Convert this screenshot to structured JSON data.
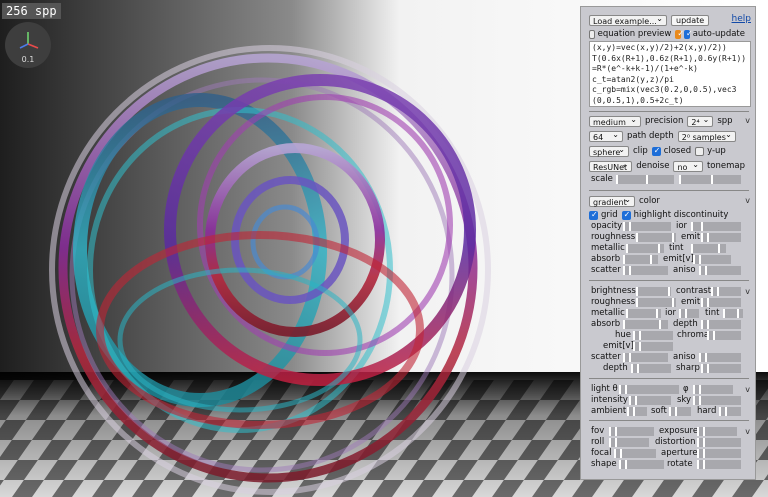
{
  "viewport": {
    "spp": "256 spp",
    "zoom": "0.1"
  },
  "panel": {
    "load_example": "Load example...",
    "update": "update",
    "help": "help",
    "equation_preview": "equation preview",
    "auto_update": "auto-update",
    "code": "(x,y)=vec(x,y)/2)+2(x,y)/2))\nT(0.6x(R+1),0.6z(R+1),0.6y(R+1))=R*(e^-k+k-1)/(1+e^-k)\nc_t=atan2(y,z)/pi\nc_rgb=mix(vec3(0.2,0,0.5),vec3(0,0.5,1),0.5+2c_t)",
    "quality": {
      "precision_value": "medium",
      "precision_label": "precision",
      "spp_value": "2⁴",
      "spp_label": "spp",
      "depth_value": "64",
      "depth_label": "path depth",
      "samples_value": "2⁰ samples",
      "clip_value": "sphere",
      "clip_label": "clip",
      "closed_label": "closed",
      "yup_label": "y-up",
      "denoise_value": "ResUNet",
      "denoise_label": "denoise",
      "tonemap_value": "no",
      "tonemap_label": "tonemap",
      "scale_label": "scale"
    },
    "color": {
      "mode_value": "gradient",
      "mode_label": "color",
      "grid_label": "grid",
      "highlight_label": "highlight discontinuity",
      "opacity": "opacity",
      "ior": "ior",
      "roughness": "roughness",
      "emit": "emit",
      "metallic": "metallic",
      "tint": "tint",
      "absorb": "absorb",
      "emit_v": "emit[v]",
      "scatter": "scatter",
      "aniso": "aniso"
    },
    "material": {
      "brightness": "brightness",
      "contrast": "contrast",
      "roughness": "roughness",
      "emit": "emit",
      "metallic": "metallic",
      "ior": "ior",
      "tint": "tint",
      "absorb": "absorb",
      "depth": "depth",
      "hue": "hue",
      "chroma": "chroma",
      "emit_v": "emit[v]",
      "scatter": "scatter",
      "aniso": "aniso",
      "depth2": "depth",
      "sharp": "sharp"
    },
    "light": {
      "theta": "light θ",
      "phi": "φ",
      "intensity": "intensity",
      "sky": "sky",
      "ambient": "ambient",
      "soft": "soft",
      "hard": "hard"
    },
    "camera": {
      "fov": "fov",
      "exposure": "exposure",
      "roll": "roll",
      "distortion": "distortion",
      "focal": "focal",
      "aperture": "aperture",
      "shape": "shape",
      "rotate": "rotate"
    },
    "collapse": "v"
  }
}
